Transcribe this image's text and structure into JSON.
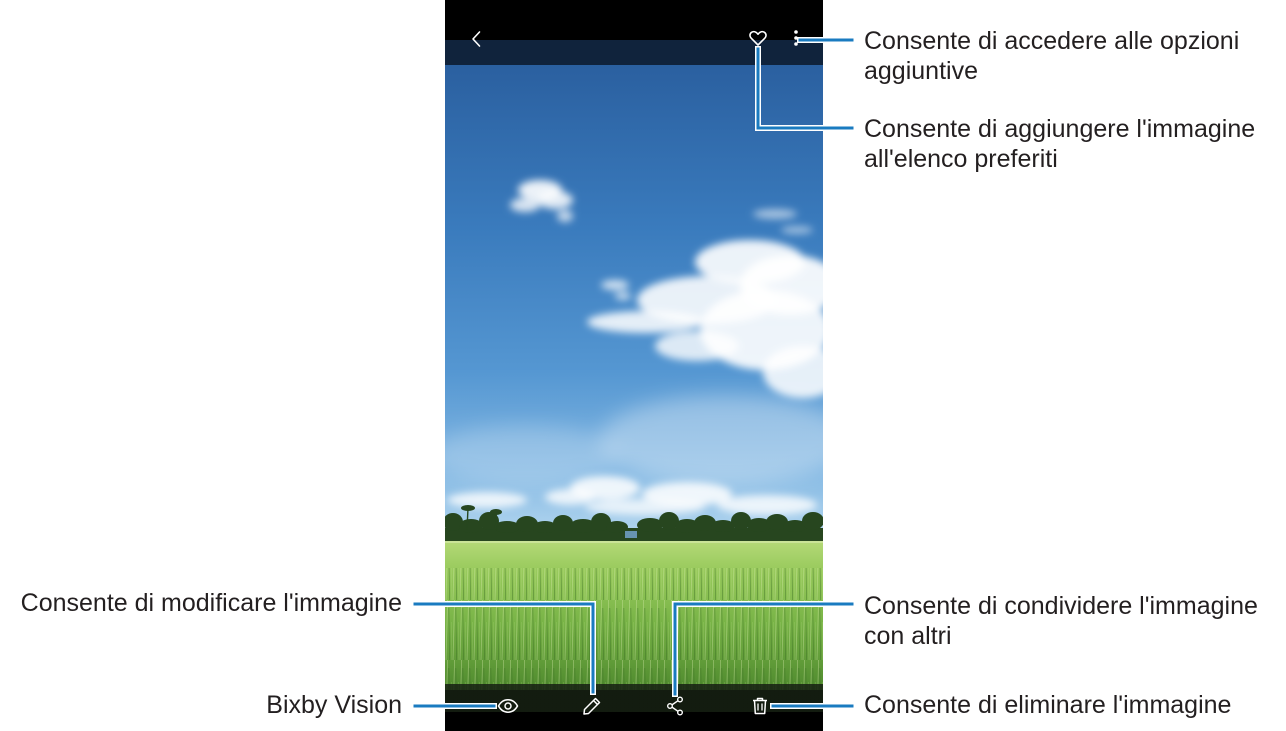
{
  "viewer": {
    "top_bar": {
      "back_icon": "chevron-left-icon",
      "favorite_icon": "heart-outline-icon",
      "more_icon": "more-vertical-icon"
    },
    "bottom_bar": {
      "bixby_icon": "eye-icon",
      "edit_icon": "pencil-icon",
      "share_icon": "share-icon",
      "delete_icon": "trash-icon"
    }
  },
  "callouts": {
    "more_options": [
      "Consente di accedere alle opzioni",
      "aggiuntive"
    ],
    "favorites": [
      "Consente di aggiungere l'immagine",
      "all'elenco preferiti"
    ],
    "edit": [
      "Consente di modificare l'immagine"
    ],
    "share": [
      "Consente di condividere l'immagine",
      "con altri"
    ],
    "bixby": [
      "Bixby Vision"
    ],
    "delete": [
      "Consente di eliminare l'immagine"
    ]
  },
  "colors": {
    "callout_line": "#1a7bc0",
    "label_text": "#231f20"
  }
}
